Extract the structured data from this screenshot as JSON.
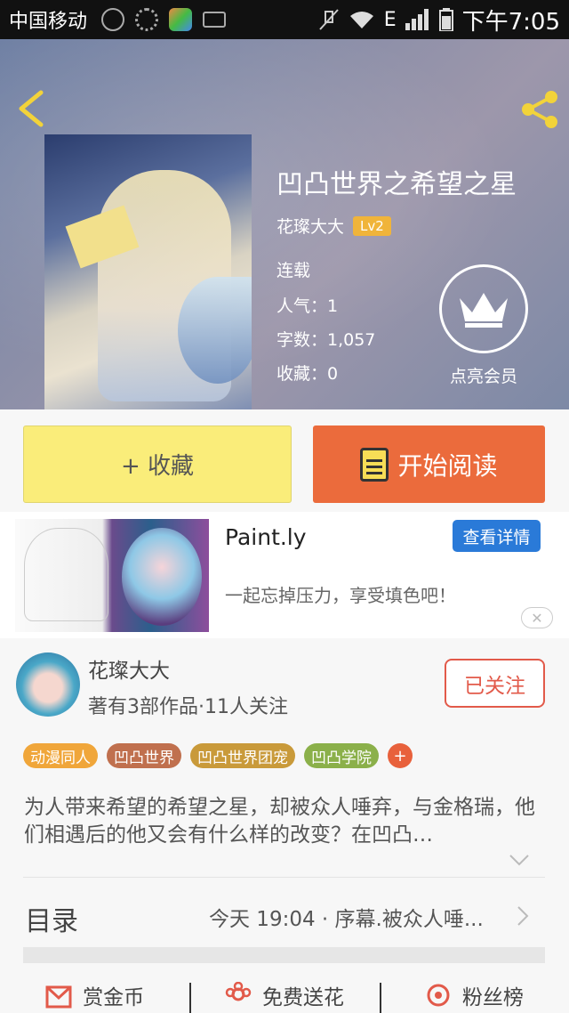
{
  "status_bar": {
    "carrier": "中国移动",
    "network": "E",
    "time": "下午7:05"
  },
  "book": {
    "title": "凹凸世界之希望之星",
    "author": "花璨大大",
    "author_level": "Lv2",
    "status": "连载",
    "popularity_label": "人气：1",
    "word_count_label": "字数：1,057",
    "favorites_label": "收藏：0"
  },
  "vip": {
    "label": "点亮会员"
  },
  "actions": {
    "collect_label": "+ 收藏",
    "read_label": "开始阅读"
  },
  "ad": {
    "app_name": "Paint.ly",
    "detail_button": "查看详情",
    "description": "一起忘掉压力，享受填色吧！",
    "close": "✕"
  },
  "author_card": {
    "name": "花璨大大",
    "stats": "著有3部作品·11人关注",
    "follow_label": "已关注"
  },
  "tags": [
    {
      "label": "动漫同人",
      "color": "#f0a63a"
    },
    {
      "label": "凹凸世界",
      "color": "#c0704e"
    },
    {
      "label": "凹凸世界团宠",
      "color": "#c99a3a"
    },
    {
      "label": "凹凸学院",
      "color": "#8bb04a"
    }
  ],
  "tag_add": "+",
  "synopsis": "为人带来希望的希望之星，却被众人唾弃，与金格瑞，他们相遇后的他又会有什么样的改变？在凹凸…",
  "toc": {
    "label": "目录",
    "latest": "今天 19:04 · 序幕.被众人唾..."
  },
  "bottom_bar": {
    "reward": "赏金币",
    "flowers": "免费送花",
    "fans": "粉丝榜"
  },
  "colors": {
    "accent_orange": "#eb6b3c",
    "collect_yellow": "#faed7a",
    "follow_red": "#e25a4a",
    "ad_blue": "#2a7ad8"
  }
}
